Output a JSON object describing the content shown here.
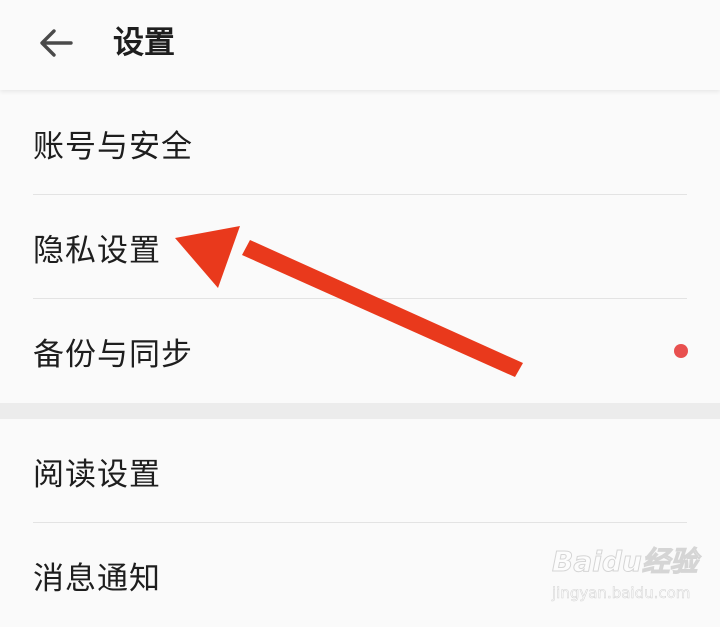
{
  "header": {
    "back_icon": "arrow-left-icon",
    "title": "设置"
  },
  "groups": [
    {
      "items": [
        {
          "label": "账号与安全"
        },
        {
          "label": "隐私设置"
        },
        {
          "label": "备份与同步",
          "badge": "red-dot"
        }
      ]
    },
    {
      "items": [
        {
          "label": "阅读设置"
        },
        {
          "label": "消息通知"
        }
      ]
    }
  ],
  "annotation": {
    "type": "red-arrow",
    "color": "#e9391c",
    "points_to": "隐私设置"
  },
  "watermark": {
    "brand": "Baidu经验",
    "url": "jingyan.baidu.com"
  },
  "colors": {
    "background": "#fafafa",
    "divider": "#e3e3e3",
    "group_gap": "#ececec",
    "badge": "#e8504f"
  }
}
